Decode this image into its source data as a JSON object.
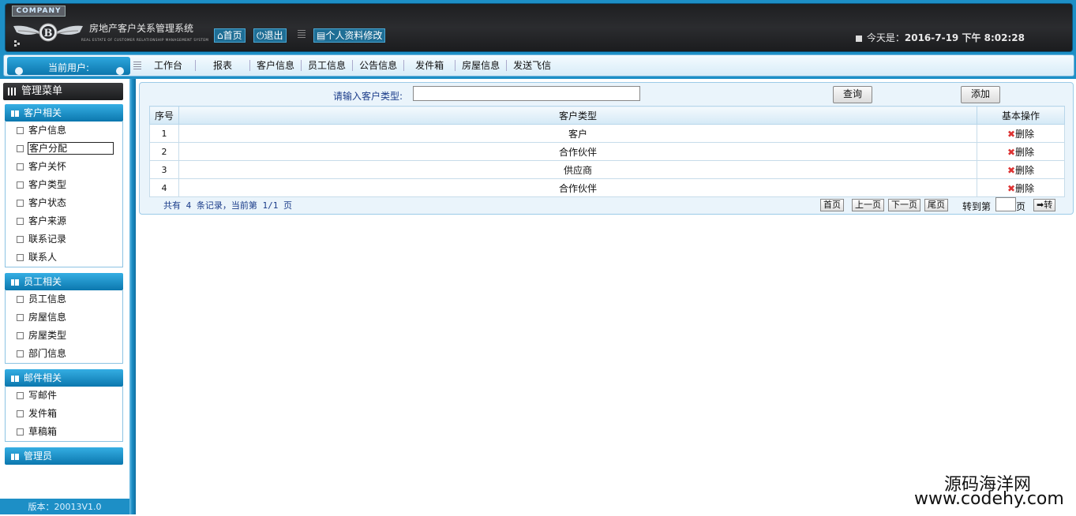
{
  "header": {
    "company_badge": "COMPANY",
    "system_title": "房地产客户关系管理系统",
    "system_subtitle": "REAL ESTATE OF CUSTOMER RELATIONSHIP MANAGEMENT SYSTEM",
    "home_label": "首页",
    "logout_label": "退出",
    "profile_label": "个人资料修改",
    "today_prefix": "今天是：",
    "today_value": "2016-7-19 下午 8:02:28"
  },
  "navbar": {
    "current_user_label": "当前用户:",
    "items": [
      "工作台",
      "报表",
      "客户信息",
      "员工信息",
      "公告信息",
      "发件箱",
      "房屋信息",
      "发送飞信"
    ]
  },
  "sidebar": {
    "title": "管理菜单",
    "groups": [
      {
        "title": "客户相关",
        "items": [
          "客户信息",
          "客户分配",
          "客户关怀",
          "客户类型",
          "客户状态",
          "客户来源",
          "联系记录",
          "联系人"
        ]
      },
      {
        "title": "员工相关",
        "items": [
          "员工信息",
          "房屋信息",
          "房屋类型",
          "部门信息"
        ]
      },
      {
        "title": "邮件相关",
        "items": [
          "写邮件",
          "发件箱",
          "草稿箱"
        ]
      },
      {
        "title": "管理员",
        "items": []
      }
    ],
    "version": "版本：20013V1.0"
  },
  "search": {
    "label": "请输入客户类型:",
    "value": "",
    "query_label": "查询",
    "add_label": "添加"
  },
  "table": {
    "headers": [
      "序号",
      "客户类型",
      "基本操作"
    ],
    "rows": [
      {
        "idx": "1",
        "type": "客户",
        "action": "删除"
      },
      {
        "idx": "2",
        "type": "合作伙伴",
        "action": "删除"
      },
      {
        "idx": "3",
        "type": "供应商",
        "action": "删除"
      },
      {
        "idx": "4",
        "type": "合作伙伴",
        "action": "删除"
      }
    ]
  },
  "pager": {
    "summary": "共有 4 条记录，当前第 1/1 页",
    "first": "首页",
    "prev": "上一页",
    "next": "下一页",
    "last": "尾页",
    "goto_label": "转到第",
    "goto_value": "",
    "page_suffix": "页",
    "go_label": "➡转"
  },
  "watermark": {
    "cn": "源码海洋网",
    "en": "www.codehy.com"
  },
  "colors": {
    "frame_blue": "#1d8fc6",
    "header_dark": "#1e1f21",
    "group_head_blue": "#0b77ae",
    "delete_red": "#d33333"
  }
}
